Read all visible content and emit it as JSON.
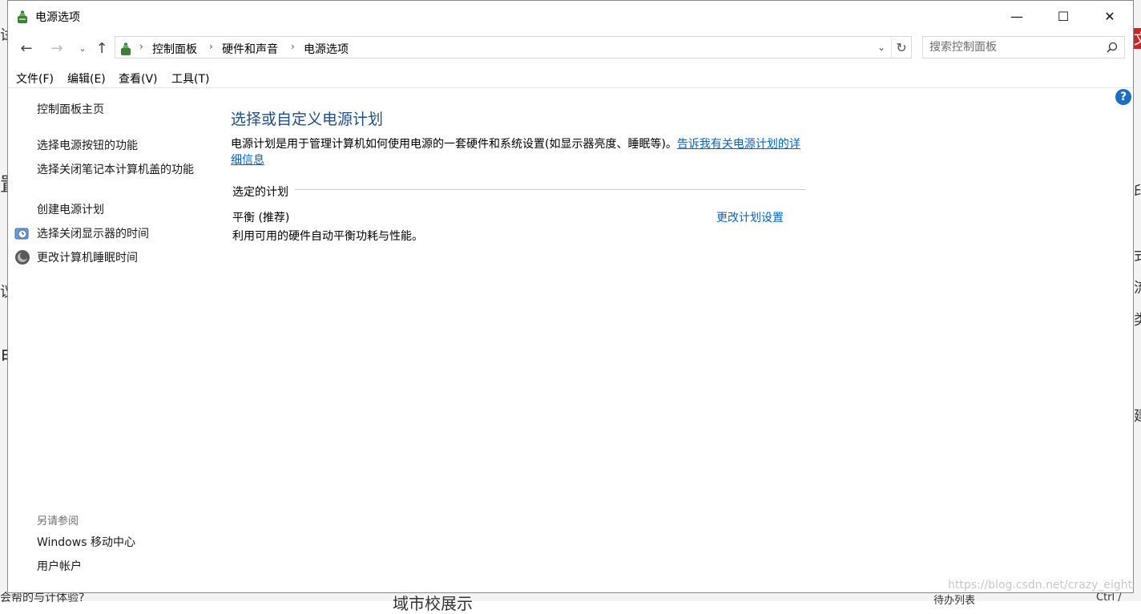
{
  "window": {
    "title": "电源选项",
    "controls": {
      "minimize": "—",
      "maximize": "☐",
      "close": "✕"
    }
  },
  "navigation": {
    "back": "←",
    "forward": "→",
    "recent": "⌄",
    "up": "↑",
    "breadcrumb": [
      "控制面板",
      "硬件和声音",
      "电源选项"
    ],
    "separator": "›",
    "dropdown": "⌄",
    "refresh": "↻",
    "search": {
      "placeholder": "搜索控制面板",
      "value": ""
    }
  },
  "menu": {
    "items": [
      "文件(F)",
      "编辑(E)",
      "查看(V)",
      "工具(T)"
    ]
  },
  "help_label": "?",
  "sidebar": {
    "home": "控制面板主页",
    "links": [
      "选择电源按钮的功能",
      "选择关闭笔记本计算机盖的功能",
      "创建电源计划",
      "选择关闭显示器的时间",
      "更改计算机睡眠时间"
    ],
    "see_also_label": "另请参阅",
    "see_also": [
      "Windows 移动中心",
      "用户帐户"
    ]
  },
  "main": {
    "title": "选择或自定义电源计划",
    "description": "电源计划是用于管理计算机如何使用电源的一套硬件和系统设置(如显示器亮度、睡眠等)。",
    "learn_more": "告诉我有关电源计划的详细信息",
    "selected_plan_heading": "选定的计划",
    "plan": {
      "name": "平衡 (推荐)",
      "description": "利用可用的硬件自动平衡功耗与性能。",
      "change_link": "更改计划设置"
    }
  },
  "background": {
    "left_glyphs": [
      "试",
      "置",
      "议",
      "电"
    ],
    "right_glyphs": [
      "文",
      "印",
      "式",
      "流",
      "类",
      "建"
    ],
    "bottom_text": "域市校展示",
    "bottom_right_text": [
      "待办列表",
      "Ctrl /"
    ],
    "bottom_left_text": "会帮的与计体验?"
  },
  "watermark": "https://blog.csdn.net/crazy_eight"
}
